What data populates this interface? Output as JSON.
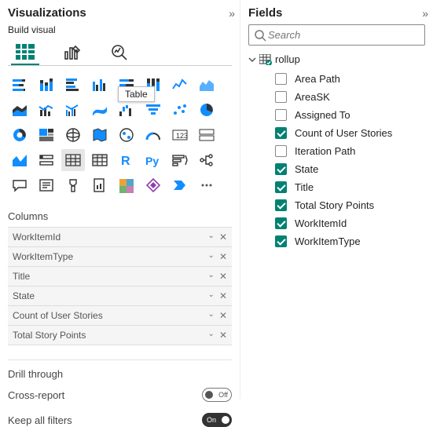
{
  "visualizations": {
    "title": "Visualizations",
    "build_label": "Build visual",
    "tooltip": "Table",
    "columns_label": "Columns",
    "columns": [
      "WorkItemId",
      "WorkItemType",
      "Title",
      "State",
      "Count of User Stories",
      "Total Story Points"
    ],
    "drill_label": "Drill through",
    "cross_report_label": "Cross-report",
    "cross_report_state": "Off",
    "keep_filters_label": "Keep all filters",
    "keep_filters_state": "On"
  },
  "fields": {
    "title": "Fields",
    "search_placeholder": "Search",
    "table_name": "rollup",
    "items": [
      {
        "label": "Area Path",
        "checked": false
      },
      {
        "label": "AreaSK",
        "checked": false
      },
      {
        "label": "Assigned To",
        "checked": false
      },
      {
        "label": "Count of User Stories",
        "checked": true
      },
      {
        "label": "Iteration Path",
        "checked": false
      },
      {
        "label": "State",
        "checked": true
      },
      {
        "label": "Title",
        "checked": true
      },
      {
        "label": "Total Story Points",
        "checked": true
      },
      {
        "label": "WorkItemId",
        "checked": true
      },
      {
        "label": "WorkItemType",
        "checked": true
      }
    ]
  }
}
